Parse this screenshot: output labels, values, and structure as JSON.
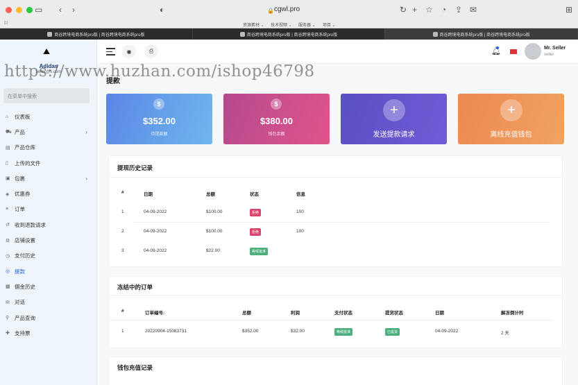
{
  "browser": {
    "url": "cgwl.pro",
    "bookmarks": [
      "资源素材 ⌄",
      "技术视频 ⌄",
      "服务器 ⌄",
      "项目 ⌄"
    ],
    "tabs": [
      {
        "label": "商谷跨境电商系统pro版 | 商谷跨境电商系统pro版"
      },
      {
        "label": "商谷跨境电商系统pro版 | 商谷跨境电商系统pro版"
      },
      {
        "label": "商谷跨境电商系统pro版 | 商谷跨境电商系统pro版"
      }
    ]
  },
  "brand": {
    "name": "Adidas",
    "sub": "seller@s.com"
  },
  "search": {
    "placeholder": "在菜单中搜索"
  },
  "menu": [
    {
      "label": "仪表板",
      "icon": "dashboard-icon",
      "glyph": "⌂"
    },
    {
      "label": "产品",
      "icon": "cart-icon",
      "glyph": "⛟",
      "chevron": "›"
    },
    {
      "label": "产品仓库",
      "icon": "warehouse-icon",
      "glyph": "▤"
    },
    {
      "label": "上传的文件",
      "icon": "file-icon",
      "glyph": "▯"
    },
    {
      "label": "包裹",
      "icon": "package-icon",
      "glyph": "▣",
      "chevron": "›"
    },
    {
      "label": "优惠券",
      "icon": "coupon-icon",
      "glyph": "◈"
    },
    {
      "label": "订单",
      "icon": "order-icon",
      "glyph": "≡"
    },
    {
      "label": "收到退款请求",
      "icon": "refund-icon",
      "glyph": "↺"
    },
    {
      "label": "店铺设置",
      "icon": "shop-icon",
      "glyph": "⚙"
    },
    {
      "label": "支付历史",
      "icon": "history-icon",
      "glyph": "◷"
    },
    {
      "label": "提款",
      "icon": "withdraw-icon",
      "glyph": "◎",
      "active": true
    },
    {
      "label": "佣金历史",
      "icon": "commission-icon",
      "glyph": "▦"
    },
    {
      "label": "对话",
      "icon": "chat-icon",
      "glyph": "✉"
    },
    {
      "label": "产品查询",
      "icon": "query-icon",
      "glyph": "⚲"
    },
    {
      "label": "支持票",
      "icon": "support-icon",
      "glyph": "✚"
    }
  ],
  "user": {
    "name": "Mr. Seller",
    "role": "seller"
  },
  "watermark": "https://www.huzhan.com/ishop46798",
  "page": {
    "title": "提款"
  },
  "cards": [
    {
      "amount": "$352.00",
      "caption": "待提款额",
      "coin": "$"
    },
    {
      "amount": "$380.00",
      "caption": "钱包余额",
      "coin": "$"
    },
    {
      "action": "发送提款请求",
      "plus": "+"
    },
    {
      "action": "离线充值钱包",
      "plus": "+"
    }
  ],
  "withdraw_history": {
    "title": "提现历史记录",
    "headers": [
      "#",
      "日期",
      "总额",
      "状态",
      "信息"
    ],
    "rows": [
      {
        "no": "1",
        "date": "04-09-2022",
        "amount": "$100.00",
        "status": "拒绝",
        "info": "100"
      },
      {
        "no": "2",
        "date": "04-09-2022",
        "amount": "$100.00",
        "status": "拒绝",
        "info": "100"
      },
      {
        "no": "3",
        "date": "04-09-2022",
        "amount": "$22.00",
        "status": "等候批准",
        "info": ""
      }
    ]
  },
  "frozen_orders": {
    "title": "冻结中的订单",
    "headers": [
      "#",
      "订单编号:",
      "总额",
      "利润",
      "支付状态",
      "提货状态",
      "日期",
      "解冻倒计时"
    ],
    "rows": [
      {
        "no": "1",
        "code": "20220904-15083731",
        "total": "$352.00",
        "profit": "$32.00",
        "pay": "等候批准",
        "pickup": "已提货",
        "date": "04-09-2022",
        "countdown": "2 天"
      }
    ]
  },
  "wallet_recharge": {
    "title": "钱包充值记录"
  },
  "colors": {
    "accent": "#2b5fd9",
    "danger": "#d9456f",
    "success": "#4caf7d"
  }
}
